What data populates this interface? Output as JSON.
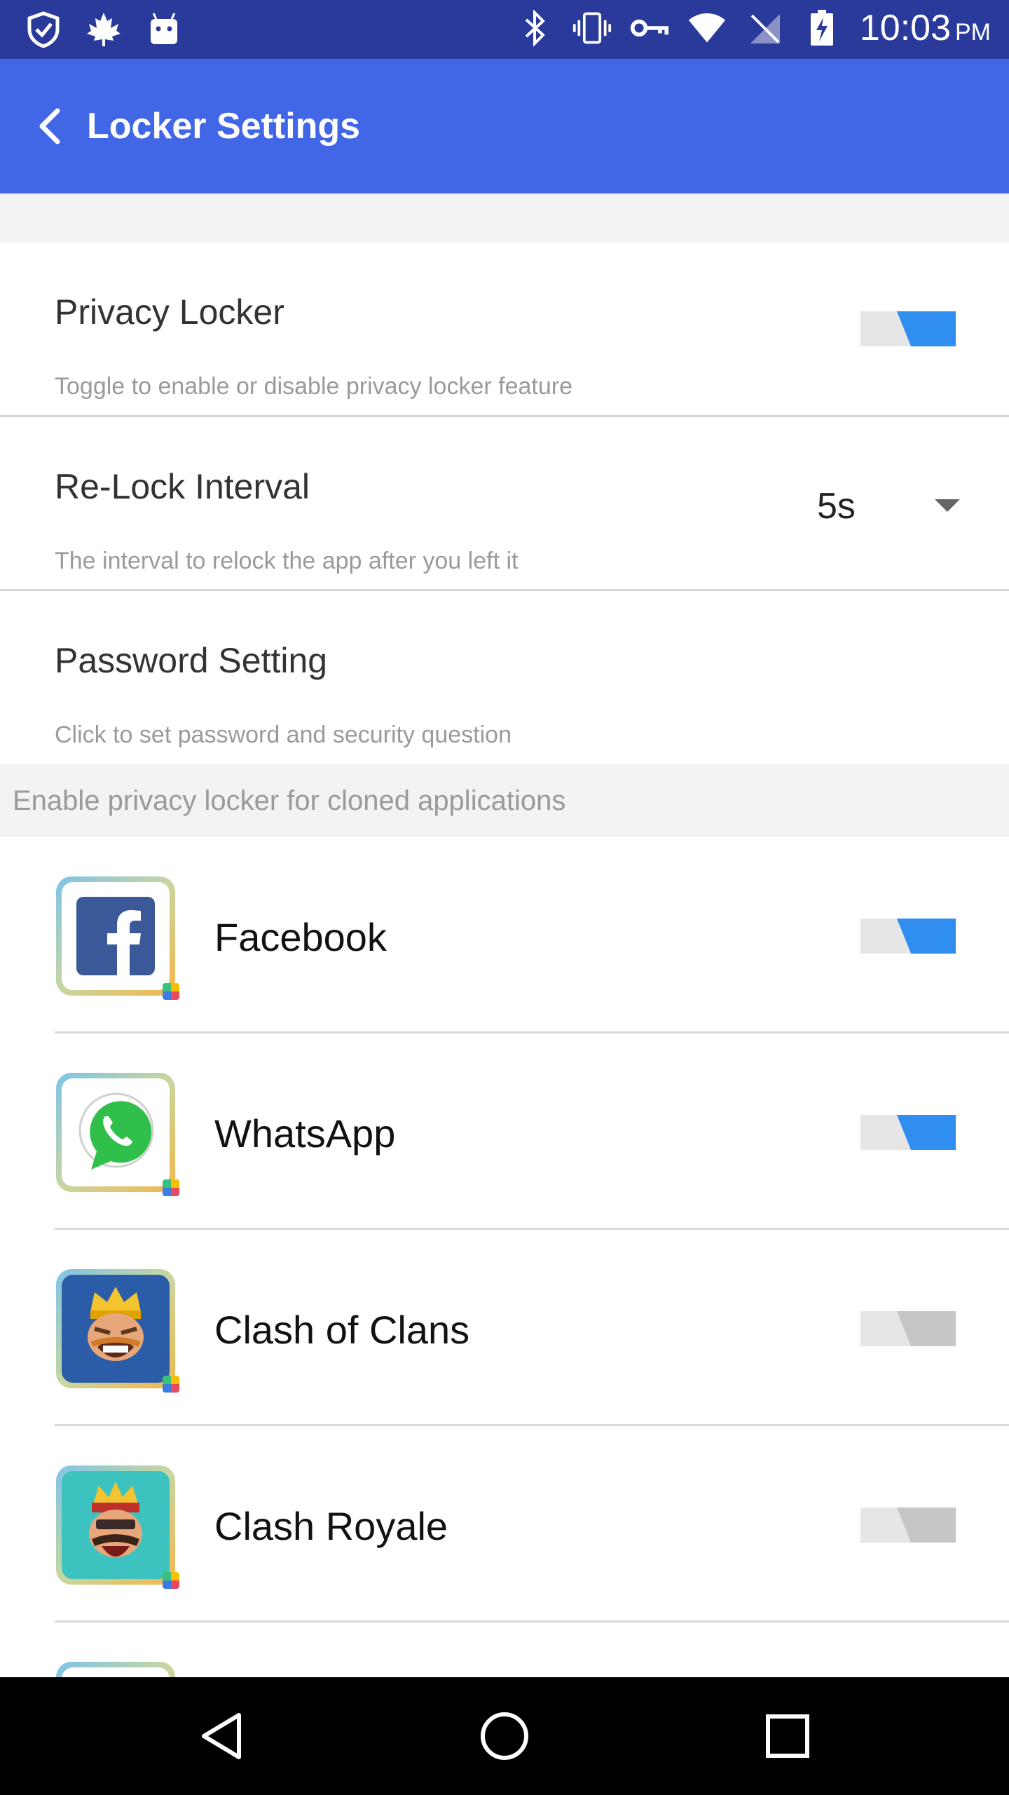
{
  "status_bar": {
    "time": "10:03",
    "ampm": "PM",
    "left_icons": [
      "shield-check-icon",
      "maple-leaf-icon",
      "android-icon"
    ],
    "right_icons": [
      "bluetooth-icon",
      "vibrate-icon",
      "vpn-key-icon",
      "wifi-icon",
      "no-signal-icon",
      "battery-charging-icon"
    ]
  },
  "app_bar": {
    "title": "Locker Settings",
    "color": "#4267e6"
  },
  "settings": {
    "privacy_locker": {
      "title": "Privacy Locker",
      "description": "Toggle to enable or disable privacy locker feature",
      "enabled": true
    },
    "relock_interval": {
      "title": "Re-Lock Interval",
      "description": "The interval to relock the app after you left it",
      "selected_value": "5s"
    },
    "password_setting": {
      "title": "Password Setting",
      "description": "Click to set password and security question"
    }
  },
  "section_header": "Enable privacy locker for cloned applications",
  "apps": [
    {
      "name": "Facebook",
      "icon": "facebook-icon",
      "enabled": true
    },
    {
      "name": "WhatsApp",
      "icon": "whatsapp-icon",
      "enabled": true
    },
    {
      "name": "Clash of Clans",
      "icon": "clash-of-clans-icon",
      "enabled": false
    },
    {
      "name": "Clash Royale",
      "icon": "clash-royale-icon",
      "enabled": false
    }
  ],
  "colors": {
    "toggle_on": "#2f8ef0",
    "toggle_off": "#c6c6c6",
    "status_bar": "#2a3a9a"
  }
}
